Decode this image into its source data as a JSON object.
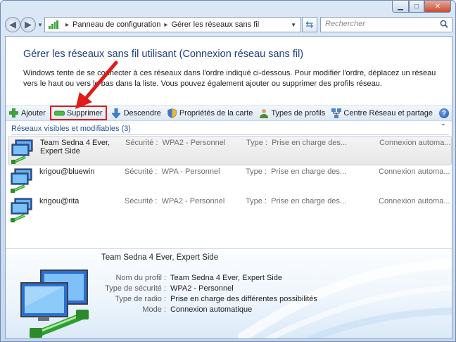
{
  "address": {
    "crumbs": [
      "Panneau de configuration",
      "Gérer les réseaux sans fil"
    ]
  },
  "search": {
    "placeholder": "Rechercher"
  },
  "page": {
    "title": "Gérer les réseaux sans fil utilisant (Connexion réseau sans fil)",
    "intro": "Windows tente de se connecter à ces réseaux dans l'ordre indiqué ci-dessous. Pour modifier l'ordre, déplacez un réseau vers le haut ou vers le bas dans la liste. Vous pouvez également ajouter ou supprimer des profils réseau."
  },
  "toolbar": {
    "add": "Ajouter",
    "remove": "Supprimer",
    "move_down": "Descendre",
    "adapter_properties": "Propriétés de la carte",
    "profile_types": "Types de profils",
    "network_center": "Centre Réseau et partage"
  },
  "group": {
    "label": "Réseaux visibles et modifiables (3)"
  },
  "networks": [
    {
      "name_line1": "Team Sedna 4 Ever,",
      "name_line2": "Expert Side",
      "security_label": "Sécurité :",
      "security": "WPA2 - Personnel",
      "type_label": "Type :",
      "type": "Prise en charge des...",
      "mode": "Connexion automa..."
    },
    {
      "name_line1": "krigou@bluewin",
      "name_line2": "",
      "security_label": "Sécurité :",
      "security": "WPA - Personnel",
      "type_label": "Type :",
      "type": "Prise en charge des...",
      "mode": "Connexion automa..."
    },
    {
      "name_line1": "krigou@rita",
      "name_line2": "",
      "security_label": "Sécurité :",
      "security": "WPA2 - Personnel",
      "type_label": "Type :",
      "type": "Prise en charge des...",
      "mode": "Connexion automa..."
    }
  ],
  "details": {
    "name": "Team Sedna 4 Ever, Expert Side",
    "profile_label": "Nom du profil :",
    "profile": "Team Sedna 4 Ever, Expert Side",
    "security_label": "Type de sécurité :",
    "security": "WPA2 - Personnel",
    "radio_label": "Type de radio :",
    "radio": "Prise en charge des différentes possibilités",
    "mode_label": "Mode :",
    "mode": "Connexion automatique"
  },
  "colors": {
    "title": "#1c3d83",
    "group": "#1f4f9c",
    "highlight": "#e01b1b"
  },
  "icons": [
    "control-panel-icon",
    "refresh-icon",
    "search-icon",
    "add-icon",
    "remove-icon",
    "move-down-icon",
    "shield-icon",
    "users-icon",
    "network-icon",
    "help-icon",
    "wireless-network-icon"
  ]
}
